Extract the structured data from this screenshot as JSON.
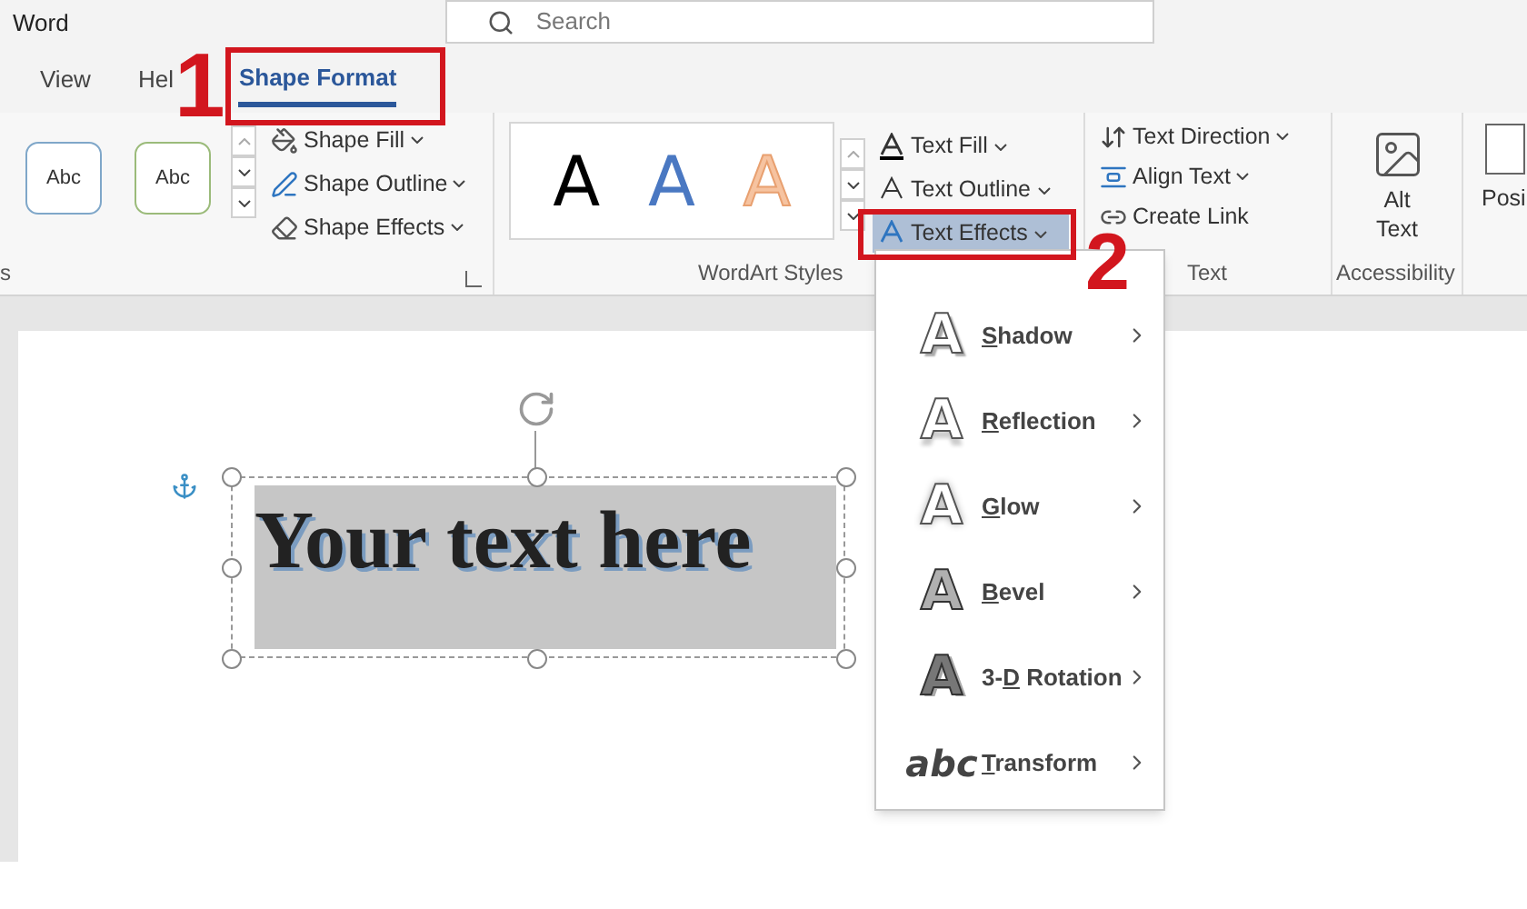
{
  "app": {
    "title": "Word"
  },
  "search": {
    "placeholder": "Search"
  },
  "tabs": [
    {
      "label": "View",
      "selected": false
    },
    {
      "label": "Hel",
      "selected": false
    },
    {
      "label": "Shape Format",
      "selected": true
    }
  ],
  "ribbon": {
    "shape_styles": {
      "group_label": "s",
      "presets": [
        {
          "label": "Abc",
          "color": "#7fa7c9"
        },
        {
          "label": "Abc",
          "color": "#9bbb7a"
        }
      ],
      "commands": [
        {
          "label": "Shape Fill"
        },
        {
          "label": "Shape Outline"
        },
        {
          "label": "Shape Effects"
        }
      ]
    },
    "wordart_styles": {
      "group_label": "WordArt Styles",
      "presets": [
        {
          "letter": "A",
          "color": "#000000"
        },
        {
          "letter": "A",
          "color": "#4a78c2"
        },
        {
          "letter": "A",
          "color": "#f6c3a0"
        }
      ],
      "commands": [
        {
          "label": "Text Fill",
          "selected": false
        },
        {
          "label": "Text Outline",
          "selected": false
        },
        {
          "label": "Text Effects",
          "selected": true
        }
      ]
    },
    "text": {
      "group_label": "Text",
      "commands": [
        {
          "label": "Text Direction",
          "dropdown": true
        },
        {
          "label": "Align Text",
          "dropdown": true
        },
        {
          "label": "Create Link",
          "dropdown": false
        }
      ]
    },
    "accessibility": {
      "group_label": "Accessibility",
      "button": "Alt Text"
    },
    "position": {
      "label": "Posi"
    }
  },
  "document": {
    "textbox": "Your text here"
  },
  "text_effects_menu": [
    {
      "glyph": "A",
      "key": "S",
      "after": "hadow"
    },
    {
      "glyph": "A",
      "key": "R",
      "after": "eflection"
    },
    {
      "glyph": "A",
      "key": "G",
      "after": "low"
    },
    {
      "glyph": "A",
      "key": "B",
      "after": "evel"
    },
    {
      "glyph": "A",
      "before": "3-",
      "key": "D",
      "after": " Rotation"
    },
    {
      "glyph": "abc",
      "key": "T",
      "after": "ransform"
    }
  ],
  "annotations": [
    {
      "label": "1"
    },
    {
      "label": "2"
    }
  ]
}
